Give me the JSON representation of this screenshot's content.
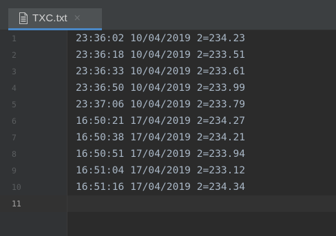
{
  "tab": {
    "file_icon": "text-file-icon",
    "filename": "TXC.txt",
    "close_glyph": "×"
  },
  "editor": {
    "lines": [
      {
        "number": "1",
        "text": "23:36:02 10/04/2019 2=234.23"
      },
      {
        "number": "2",
        "text": "23:36:18 10/04/2019 2=233.51"
      },
      {
        "number": "3",
        "text": "23:36:33 10/04/2019 2=233.61"
      },
      {
        "number": "4",
        "text": "23:36:50 10/04/2019 2=233.99"
      },
      {
        "number": "5",
        "text": "23:37:06 10/04/2019 2=233.79"
      },
      {
        "number": "6",
        "text": "16:50:21 17/04/2019 2=234.27"
      },
      {
        "number": "7",
        "text": "16:50:38 17/04/2019 2=234.21"
      },
      {
        "number": "8",
        "text": "16:50:51 17/04/2019 2=233.94"
      },
      {
        "number": "9",
        "text": "16:51:04 17/04/2019 2=233.12"
      },
      {
        "number": "10",
        "text": "16:51:16 17/04/2019 2=234.34"
      },
      {
        "number": "11",
        "text": ""
      }
    ]
  },
  "colors": {
    "tab_accent": "#4a88c7",
    "editor_background": "#2b2b2b",
    "text": "#a9b7c6"
  }
}
